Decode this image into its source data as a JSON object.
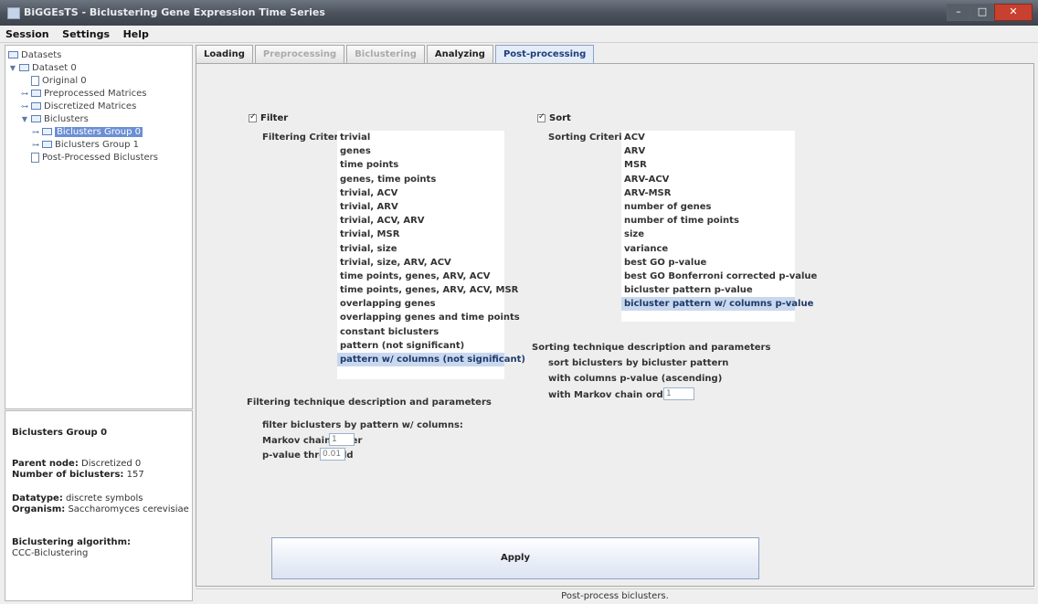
{
  "window": {
    "title": "BiGGEsTS - Biclustering Gene Expression Time Series",
    "minimize": "–",
    "maximize": "□",
    "close": "✕"
  },
  "menu": [
    "Session",
    "Settings",
    "Help"
  ],
  "tree": [
    {
      "label": "Datasets",
      "level": 0,
      "type": "folder"
    },
    {
      "label": "Dataset 0",
      "level": 1,
      "type": "folder"
    },
    {
      "label": "Original 0",
      "level": 2,
      "type": "doc"
    },
    {
      "label": "Preprocessed Matrices",
      "level": 2,
      "type": "folder"
    },
    {
      "label": "Discretized Matrices",
      "level": 2,
      "type": "folder"
    },
    {
      "label": "Biclusters",
      "level": 2,
      "type": "folder"
    },
    {
      "label": "Biclusters Group 0",
      "level": 3,
      "type": "folder",
      "selected": true
    },
    {
      "label": "Biclusters Group 1",
      "level": 3,
      "type": "folder"
    },
    {
      "label": "Post-Processed Biclusters",
      "level": 2,
      "type": "doc"
    }
  ],
  "info": {
    "heading": "Biclusters Group 0",
    "parent_label": "Parent node:",
    "parent_value": "Discretized 0",
    "number_label": "Number of biclusters:",
    "number_value": "157",
    "datatype_label": "Datatype:",
    "datatype_value": "discrete symbols",
    "organism_label": "Organism:",
    "organism_value": "Saccharomyces cerevisiae",
    "algorithm_label": "Biclustering algorithm:",
    "algorithm_value": "CCC-Biclustering"
  },
  "tabs": [
    {
      "label": "Loading",
      "state": "normal"
    },
    {
      "label": "Preprocessing",
      "state": "disabled"
    },
    {
      "label": "Biclustering",
      "state": "disabled"
    },
    {
      "label": "Analyzing",
      "state": "normal"
    },
    {
      "label": "Post-processing",
      "state": "active"
    }
  ],
  "filter": {
    "checkbox_label": "Filter",
    "criteria_label": "Filtering Criteria",
    "items": [
      "trivial",
      "genes",
      "time points",
      "genes, time points",
      "trivial, ACV",
      "trivial, ARV",
      "trivial, ACV, ARV",
      "trivial, MSR",
      "trivial, size",
      "trivial, size, ARV, ACV",
      "time points, genes, ARV, ACV",
      "time points, genes, ARV, ACV, MSR",
      "overlapping genes",
      "overlapping genes and time points",
      "constant biclusters",
      "pattern (not significant)",
      "pattern w/ columns (not significant)"
    ],
    "selected_index": 16,
    "technique_heading": "Filtering technique description and parameters",
    "technique_desc": "filter biclusters by pattern w/ columns:",
    "markov_label": "Markov chain order",
    "markov_value": "1",
    "pvalue_label": "p-value threshold",
    "pvalue_value": "0.01"
  },
  "sort": {
    "checkbox_label": "Sort",
    "criteria_label": "Sorting Criteria",
    "items": [
      "ACV",
      "ARV",
      "MSR",
      "ARV-ACV",
      "ARV-MSR",
      "number of genes",
      "number of time points",
      "size",
      "variance",
      "best GO p-value",
      "best GO Bonferroni corrected p-value",
      "bicluster pattern p-value",
      "bicluster pattern w/ columns p-value"
    ],
    "selected_index": 12,
    "technique_heading": "Sorting technique description and parameters",
    "technique_desc": "sort biclusters by bicluster pattern",
    "technique_desc2": "with columns p-value (ascending)",
    "markov_label": "with Markov chain order",
    "markov_value": "1"
  },
  "apply_label": "Apply",
  "status_text": "Post-process biclusters."
}
